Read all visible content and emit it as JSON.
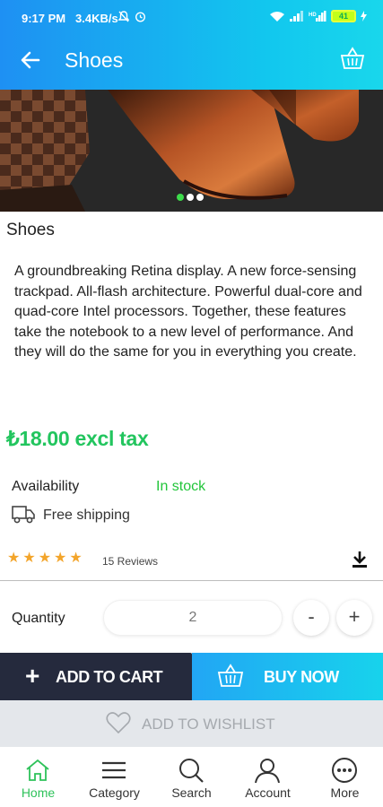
{
  "status_bar": {
    "time": "9:17 PM",
    "speed": "3.4KB/s",
    "battery": "41"
  },
  "header": {
    "title": "Shoes",
    "back_icon": "arrow-left-icon",
    "cart_icon": "basket-icon"
  },
  "carousel": {
    "slides": 3,
    "active_slide": 1
  },
  "product": {
    "name": "Shoes",
    "description": "A groundbreaking Retina display. A new force-sensing trackpad. All-flash architecture. Powerful dual-core and quad-core Intel processors. Together, these features take the notebook to a new level of performance. And they will do the same for you in everything you create.",
    "price": "₺18.00 excl tax",
    "availability_label": "Availability",
    "availability_value": "In stock",
    "shipping": "Free shipping",
    "rating": 5,
    "rating_max": 5,
    "reviews": "15 Reviews"
  },
  "quantity": {
    "label": "Quantity",
    "value": "2",
    "minus": "-",
    "plus": "+"
  },
  "actions": {
    "add_to_cart_icon": "+",
    "add_to_cart": "ADD TO CART",
    "buy_now": "BUY NOW",
    "add_to_wishlist": "ADD TO WISHLIST"
  },
  "bottom_nav": {
    "items": [
      {
        "label": "Home",
        "icon": "home-icon",
        "active": true
      },
      {
        "label": "Category",
        "icon": "menu-icon",
        "active": false
      },
      {
        "label": "Search",
        "icon": "search-icon",
        "active": false
      },
      {
        "label": "Account",
        "icon": "account-icon",
        "active": false
      },
      {
        "label": "More",
        "icon": "more-icon",
        "active": false
      }
    ]
  },
  "colors": {
    "header_start": "#1e90f3",
    "header_end": "#19d7ec",
    "price_green": "#22c55e",
    "cart_button": "#252a3d",
    "star": "#f3a52b",
    "active_nav": "#2ec25a"
  }
}
